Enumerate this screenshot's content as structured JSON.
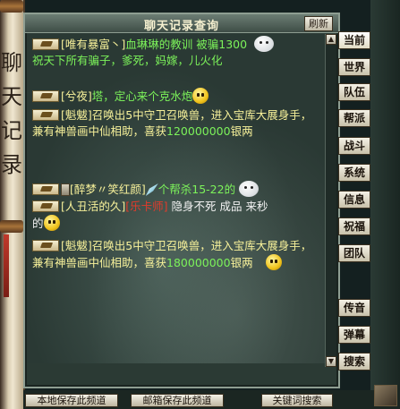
{
  "window": {
    "title": "聊天记录查询",
    "refresh_label": "刷新"
  },
  "left_scroll": {
    "chars": [
      "聊",
      "天",
      "记",
      "录"
    ]
  },
  "tabs": [
    "当前",
    "世界",
    "队伍",
    "帮派",
    "战斗",
    "系统",
    "信息",
    "祝福",
    "团队"
  ],
  "side_buttons": [
    "传音",
    "弹幕",
    "搜索"
  ],
  "bottom_buttons": {
    "save_local": "本地保存此频道",
    "save_mail": "邮箱保存此频道",
    "keyword_search": "关键词搜索"
  },
  "messages": [
    {
      "sender": "[唯有暴富丶]",
      "part1": "血琳琳的教训",
      "part2": " 被骗1300",
      "part3": "祝天下所有骗子，爹死，妈嫁，儿火化"
    },
    {
      "sender": "[兮夜]",
      "text": "塔，定心来个克水炮"
    },
    {
      "sender": "[魁魃]",
      "text_a": "召唤出5中守卫召唤兽，进入宝库大展身手，兼有神兽画中仙相助，喜获",
      "amount": "120000000",
      "text_b": "银两"
    },
    {
      "sender": "[醉梦〃笑红颜]",
      "text": "个帮杀15-22的"
    },
    {
      "sender": "[人丑活的久]",
      "red": "[乐卡师]",
      "white": " 隐身不死  成品  来秒",
      "tail": "的"
    },
    {
      "sender": "[魁魃]",
      "text_a": "召唤出5中守卫召唤兽，进入宝库大展身手，兼有神兽画中仙相助，喜获",
      "amount": "180000000",
      "text_b": "银两"
    }
  ],
  "colors": {
    "chat_text": "#f7f19a",
    "highlight_green": "#7cf25a",
    "highlight_red": "#e23b2b"
  }
}
